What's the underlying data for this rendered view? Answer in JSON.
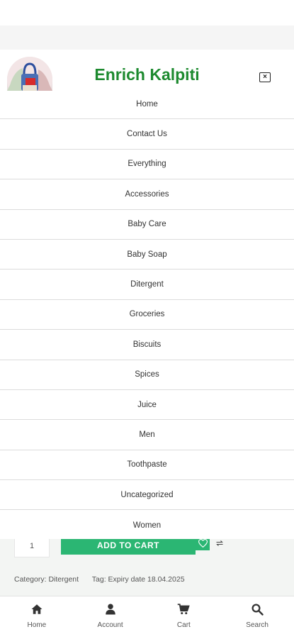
{
  "header": {
    "site_title": "Enrich Kalpiti",
    "close_label": "×"
  },
  "menu": {
    "items": [
      {
        "label": "Home"
      },
      {
        "label": "Contact Us"
      },
      {
        "label": "Everything"
      },
      {
        "label": "Accessories"
      },
      {
        "label": "Baby Care"
      },
      {
        "label": "Baby Soap"
      },
      {
        "label": "Ditergent"
      },
      {
        "label": "Groceries"
      },
      {
        "label": "Biscuits"
      },
      {
        "label": "Spices"
      },
      {
        "label": "Juice"
      },
      {
        "label": "Men"
      },
      {
        "label": "Toothpaste"
      },
      {
        "label": "Uncategorized"
      },
      {
        "label": "Women"
      }
    ]
  },
  "product": {
    "quantity": "1",
    "add_to_cart_label": "ADD TO CART",
    "category_text": "Category: Ditergent",
    "tag_text": "Tag: Expiry date 18.04.2025"
  },
  "bottom_nav": {
    "items": [
      {
        "label": "Home",
        "icon": "home-icon"
      },
      {
        "label": "Account",
        "icon": "user-icon"
      },
      {
        "label": "Cart",
        "icon": "cart-icon"
      },
      {
        "label": "Search",
        "icon": "search-icon"
      }
    ]
  },
  "colors": {
    "brand_green": "#1d8a2f",
    "button_green": "#2bb673"
  }
}
